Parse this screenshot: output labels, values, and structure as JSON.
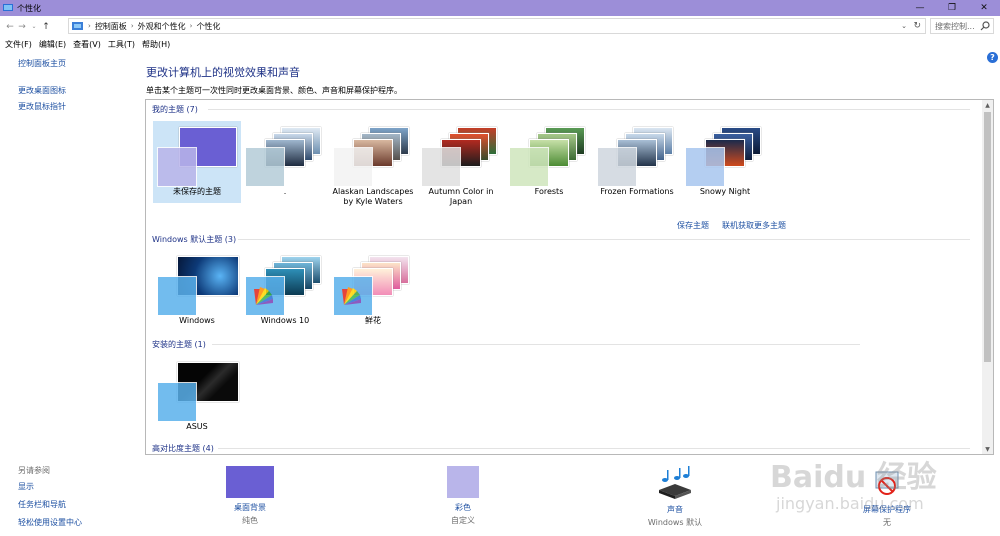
{
  "window": {
    "title": "个性化"
  },
  "titlebar_buttons": {
    "minimize": "—",
    "restore": "❐",
    "close": "✕"
  },
  "address": {
    "crumbs": [
      "控制面板",
      "外观和个性化",
      "个性化"
    ],
    "search_placeholder": "搜索控制..."
  },
  "menu": [
    "文件(F)",
    "编辑(E)",
    "查看(V)",
    "工具(T)",
    "帮助(H)"
  ],
  "leftnav": {
    "home": "控制面板主页",
    "desktop_icons": "更改桌面图标",
    "mouse_pointers": "更改鼠标指针"
  },
  "seealso": {
    "header": "另请参阅",
    "links": [
      "显示",
      "任务栏和导航",
      "轻松使用设置中心"
    ]
  },
  "main": {
    "heading": "更改计算机上的视觉效果和声音",
    "subheading": "单击某个主题可一次性同时更改桌面背景、颜色、声音和屏幕保护程序。"
  },
  "groups": {
    "my_themes": {
      "label": "我的主题 (7)"
    },
    "windows_defaults": {
      "label": "Windows 默认主题 (3)"
    },
    "installed": {
      "label": "安装的主题 (1)"
    },
    "high_contrast": {
      "label": "高对比度主题 (4)"
    }
  },
  "my_themes": [
    {
      "label": "未保存的主题",
      "selected": true
    },
    {
      "label": "."
    },
    {
      "label": "Alaskan Landscapes by Kyle Waters"
    },
    {
      "label": "Autumn Color in Japan"
    },
    {
      "label": "Forests"
    },
    {
      "label": "Frozen Formations"
    },
    {
      "label": "Snowy Night"
    }
  ],
  "windows_themes": [
    {
      "label": "Windows"
    },
    {
      "label": "Windows 10"
    },
    {
      "label": "鲜花"
    }
  ],
  "installed_themes": [
    {
      "label": "ASUS"
    }
  ],
  "actions": {
    "save_theme": "保存主题",
    "get_more": "联机获取更多主题"
  },
  "bottom": {
    "background": {
      "label": "桌面背景",
      "sub": "纯色",
      "color": "#6a5fd3"
    },
    "color": {
      "label": "彩色",
      "sub": "自定义",
      "color": "#b9b5ea"
    },
    "sound": {
      "label": "声音",
      "sub": "Windows 默认"
    },
    "screensaver": {
      "label": "屏幕保护程序",
      "sub": "无"
    }
  },
  "watermark": {
    "line1": "Baidu 经验",
    "line2": "jingyan.baidu.com"
  }
}
